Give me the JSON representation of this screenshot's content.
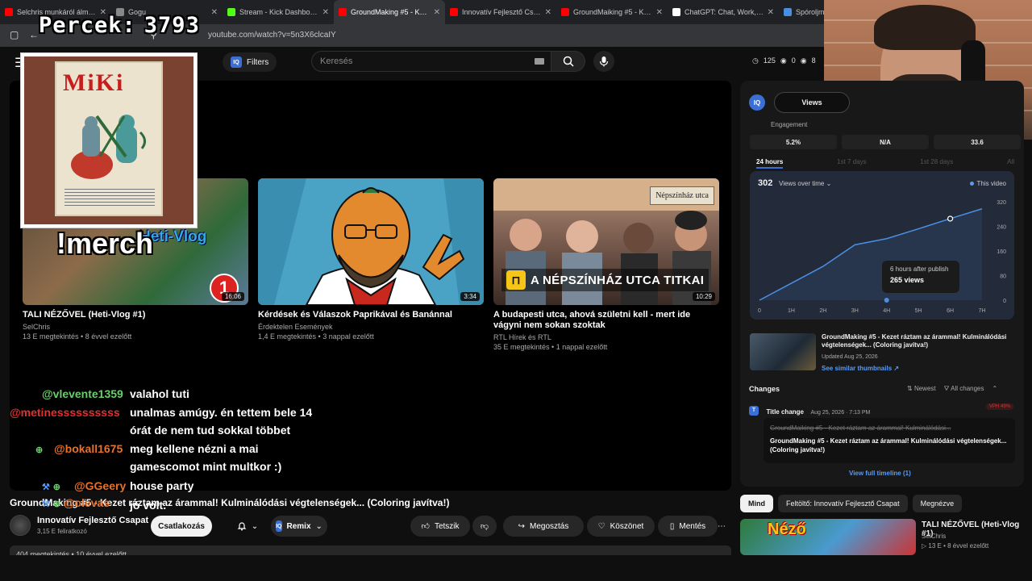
{
  "timer": {
    "label": "Percek:",
    "value": "3793"
  },
  "browser": {
    "tabs": [
      {
        "title": "Selchris munkáról álmodik, c",
        "favicon_color": "#ff0000"
      },
      {
        "title": "Gogu",
        "favicon_color": "#888888"
      },
      {
        "title": "Stream - Kick Dashboard",
        "favicon_color": "#53fc18"
      },
      {
        "title": "GroundMaking #5 - Kezet rá",
        "favicon_color": "#ff0000",
        "active": true
      },
      {
        "title": "Innovatív Fejlesztő Csapat",
        "favicon_color": "#ff0000"
      },
      {
        "title": "GroundMaiking #5 - Kezet rázta",
        "favicon_color": "#ff0000"
      },
      {
        "title": "ChatGPT: Chat, Work, Create",
        "favicon_color": "#ffffff"
      },
      {
        "title": "Spóroljm",
        "favicon_color": "#4a90e2"
      }
    ],
    "url": "youtube.com/watch?v=5n3X6clcaIY"
  },
  "header": {
    "filters_label": "Filters",
    "iq_label": "IQ",
    "search_placeholder": "Keresés",
    "stats": [
      "125",
      "0",
      "8"
    ]
  },
  "overlay": {
    "merch": "!merch",
    "heti_vlog": "Heti-Vlog",
    "badge_number": "1",
    "poster_title": "MiKi"
  },
  "suggested": [
    {
      "title": "TALI NÉZŐVEL (Heti-Vlog #1)",
      "channel": "SelChris",
      "meta": "13 E megtekintés • 8 évvel ezelőtt",
      "duration": "16:06"
    },
    {
      "title": "Kérdések és Válaszok Paprikával és Banánnal",
      "channel": "Érdektelen Események",
      "meta": "1,4 E megtekintés • 3 nappal ezelőtt",
      "duration": "3:34"
    },
    {
      "title": "A budapesti utca, ahová születni kell - mert ide vágyni nem sokan szoktak",
      "channel": "RTL Hírek és RTL",
      "meta": "35 E megtekintés • 1 nappal ezelőtt",
      "duration": "10:29",
      "sign": "Népszínház utca",
      "banner": "A NÉPSZÍNHÁZ UTCA TITKAI"
    }
  ],
  "chat": [
    {
      "user": "@vlevente1359",
      "text": "valahol tuti"
    },
    {
      "user": "@metinessssssssss",
      "text": "unalmas amúgy. én tettem bele 14"
    },
    {
      "user": "",
      "text": "órát de nem tud sokkal többet"
    },
    {
      "user": "@bokall1675",
      "text": "meg kellene nézni a mai"
    },
    {
      "user": "",
      "text": "gamescomot mint multkor :)"
    },
    {
      "user": "@GGeery",
      "text": "house party"
    },
    {
      "user": "@olevas",
      "text": "jó volt."
    }
  ],
  "video": {
    "title": "GroundMaking #5 - Kezet ráztam az árammal! Kulminálódási végtelenségek... (Coloring javítva!)",
    "channel": "Innovatív Fejlesztő Csapat",
    "subs": "3,15 E feliratkozó",
    "join_label": "Csatlakozás",
    "remix_label": "Remix",
    "like_label": "Tetszik",
    "share_label": "Megosztás",
    "thanks_label": "Köszönet",
    "save_label": "Mentés",
    "desc_peek": "404 megtekintés • 10 évvel ezelőtt"
  },
  "panel": {
    "iq_label": "IQ",
    "views_toggle": "Views",
    "engagement_label": "Engagement",
    "metrics": [
      "5.2%",
      "N/A",
      "33.6"
    ],
    "ranges": [
      {
        "label": "24 hours",
        "active": true
      },
      {
        "label": "1st 7 days"
      },
      {
        "label": "1st 28 days"
      },
      {
        "label": "All"
      }
    ],
    "views_total": "302",
    "views_over_time": "Views over time",
    "this_video": "This video",
    "tooltip_line1": "6 hours after publish",
    "tooltip_line2": "265 views",
    "related": {
      "title": "GroundMaking #5 - Kezet ráztam az árammal! Kulminálódási végtelenségek... (Coloring javítva!)",
      "updated": "Updated Aug 25, 2026",
      "link": "See similar thumbnails ↗"
    },
    "changes": {
      "heading": "Changes",
      "newest": "Newest",
      "all_changes": "All changes",
      "type": "Title change",
      "date": "Aug 25, 2026 · 7:13 PM",
      "vph": "VPH 49%",
      "old": "GroundMaiking #5 - Kezet ráztam az árammal! Kulminálódási...",
      "new": "GroundMaking #5 - Kezet ráztam az árammal! Kulminálódási végtelenségek... (Coloring javítva!)",
      "timeline_link": "View full timeline (1)"
    }
  },
  "chart_data": {
    "type": "line",
    "title": "Views over time",
    "x": [
      "0",
      "1H",
      "2H",
      "3H",
      "4H",
      "5H",
      "6H",
      "7H"
    ],
    "values": [
      0,
      55,
      110,
      180,
      200,
      232,
      265,
      297
    ],
    "ylim": [
      0,
      320
    ],
    "yticks": [
      "0",
      "80",
      "160",
      "240",
      "320"
    ],
    "highlight_index": 6,
    "line_color": "#4a90e2"
  },
  "chips": [
    "Mind",
    "Feltöltő: Innovatív Fejlesztő Csapat",
    "Megnézve"
  ],
  "recommendation": {
    "title": "TALI NÉZŐVEL (Heti-Vlog #1)",
    "channel": "SelChris",
    "meta": "13 E • 8 évvel ezelőtt",
    "thumb_text": "Néző"
  }
}
